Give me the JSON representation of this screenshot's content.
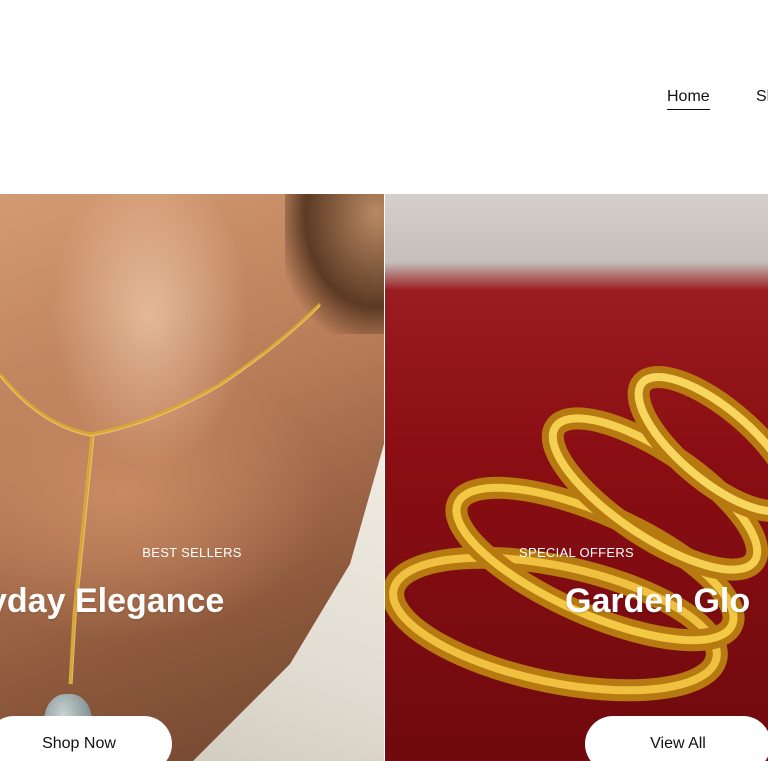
{
  "nav": {
    "items": [
      {
        "label": "Home",
        "active": true
      },
      {
        "label": "Sh"
      }
    ]
  },
  "collections": [
    {
      "eyebrow": "BEST SELLERS",
      "title": "yday Elegance",
      "button": "Shop Now"
    },
    {
      "eyebrow": "SPECIAL OFFERS",
      "title": "Garden Glo",
      "button": "View All"
    }
  ],
  "colors": {
    "background": "#ffffff",
    "text": "#111111",
    "overlay_text": "#ffffff",
    "velvet": "#8a0e13",
    "gold": "#d9a628"
  }
}
